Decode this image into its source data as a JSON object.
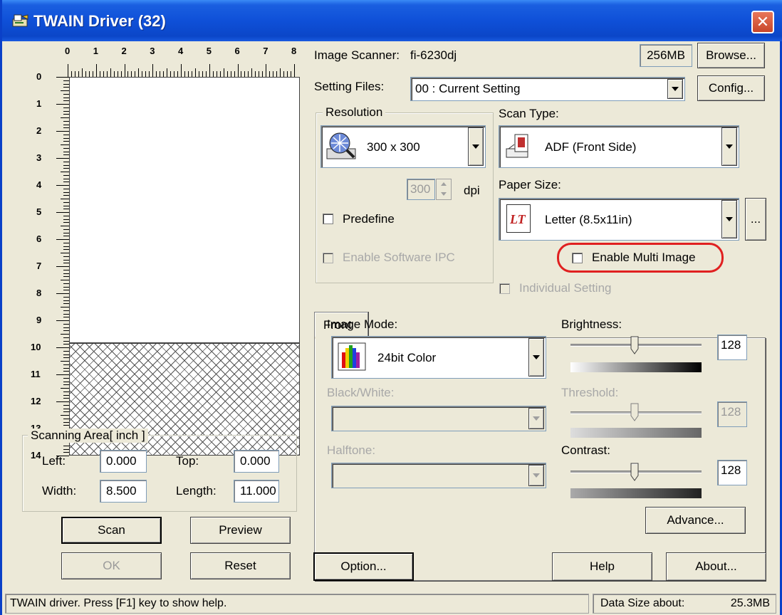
{
  "window": {
    "title": "TWAIN Driver (32)",
    "close_glyph": "✕"
  },
  "ruler": {
    "h_ticks": [
      "0",
      "1",
      "2",
      "3",
      "4",
      "5",
      "6",
      "7",
      "8"
    ],
    "v_ticks": [
      "0",
      "1",
      "2",
      "3",
      "4",
      "5",
      "6",
      "7",
      "8",
      "9",
      "10",
      "11",
      "12",
      "13",
      "14"
    ]
  },
  "scan_area": {
    "title": "Scanning Area[ inch ]",
    "left_label": "Left:",
    "left_value": "0.000",
    "top_label": "Top:",
    "top_value": "0.000",
    "width_label": "Width:",
    "width_value": "8.500",
    "length_label": "Length:",
    "length_value": "11.000"
  },
  "left_buttons": {
    "scan": "Scan",
    "preview": "Preview",
    "ok": "OK",
    "reset": "Reset"
  },
  "scanner": {
    "label": "Image Scanner:",
    "name": "fi-6230dj",
    "memory": "256MB",
    "browse": "Browse..."
  },
  "setting_files": {
    "label": "Setting Files:",
    "value": "00 : Current Setting",
    "config": "Config..."
  },
  "resolution": {
    "title": "Resolution",
    "value": "300 x 300",
    "dpi_value": "300",
    "dpi_unit": "dpi",
    "predefine": "Predefine"
  },
  "scan_type": {
    "label": "Scan Type:",
    "value": "ADF (Front Side)"
  },
  "paper_size": {
    "label": "Paper Size:",
    "value": "Letter (8.5x11in)",
    "more": "...",
    "icon_text": "LT"
  },
  "options": {
    "software_ipc": "Enable Software IPC",
    "multi_image": "Enable Multi Image",
    "individual": "Individual Setting"
  },
  "tab": {
    "front": "Front"
  },
  "image_mode": {
    "label": "Image Mode:",
    "value": "24bit Color"
  },
  "bw": {
    "label": "Black/White:",
    "halftone": "Halftone:"
  },
  "brightness": {
    "label": "Brightness:",
    "value": "128",
    "level": 0.5
  },
  "threshold": {
    "label": "Threshold:",
    "value": "128",
    "level": 0.5
  },
  "contrast": {
    "label": "Contrast:",
    "value": "128",
    "level": 0.5
  },
  "advance": "Advance...",
  "bottom_buttons": {
    "option": "Option...",
    "help": "Help",
    "about": "About..."
  },
  "status": {
    "help_text": "TWAIN driver. Press [F1] key to show help.",
    "data_size_label": "Data Size about:",
    "data_size_value": "25.3MB"
  }
}
